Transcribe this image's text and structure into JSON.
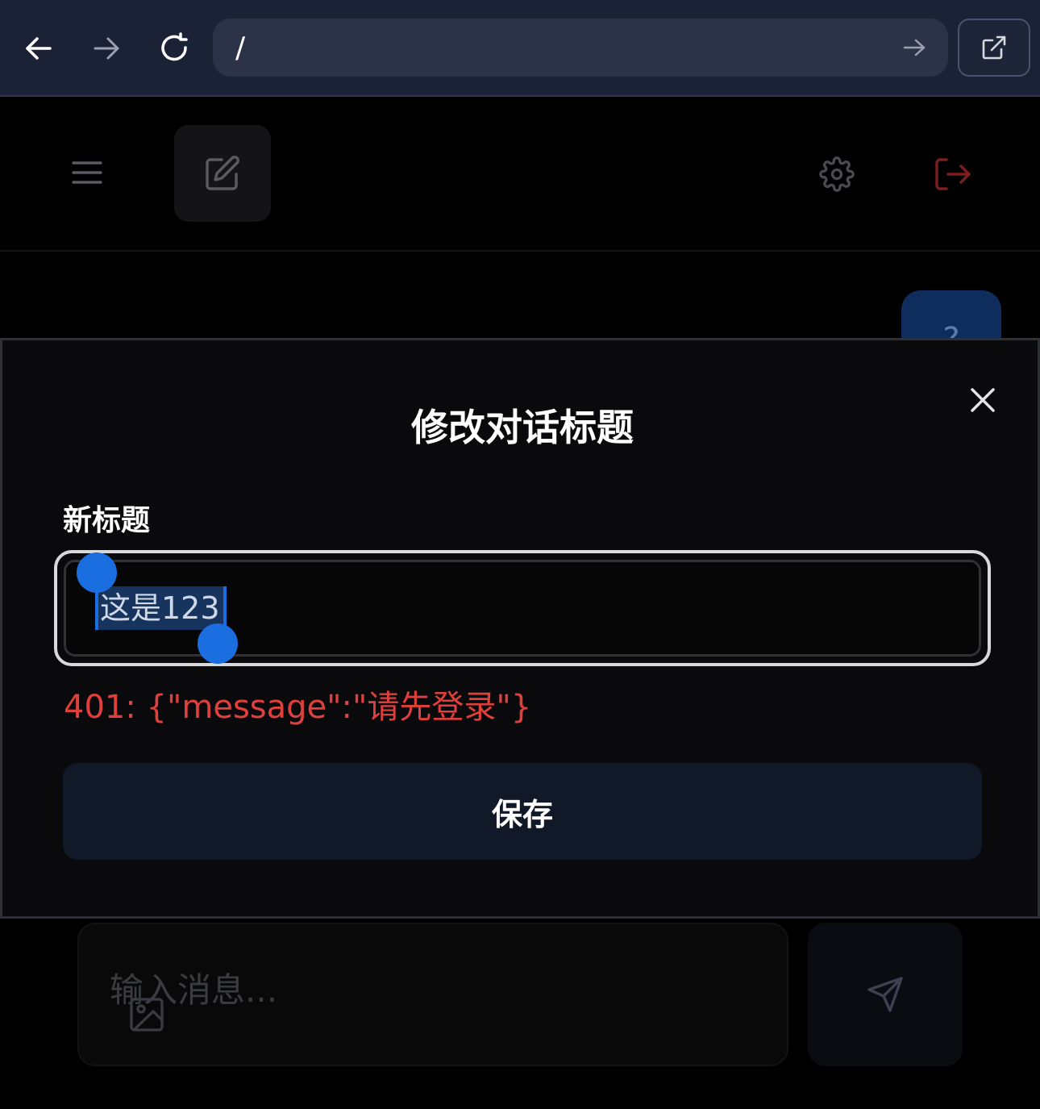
{
  "browser": {
    "url": "/",
    "icons": [
      "back-arrow-icon",
      "forward-arrow-icon",
      "reload-icon",
      "go-arrow-icon",
      "open-external-icon"
    ]
  },
  "header": {
    "icons": [
      "menu-icon",
      "edit-icon",
      "gear-icon",
      "logout-icon"
    ],
    "logout_color": "#7a1e1e"
  },
  "conversation": {
    "user_bubble_text": "?"
  },
  "modal": {
    "title": "修改对话标题",
    "field_label": "新标题",
    "input_value": "这是123",
    "error": "401: {\"message\":\"请先登录\"}",
    "save_label": "保存",
    "close_icon": "close-icon"
  },
  "composer": {
    "placeholder": "输入消息...",
    "icons": [
      "image-icon",
      "send-icon"
    ]
  },
  "colors": {
    "browser_bg": "#1b2236",
    "modal_bg": "#0a0a0c",
    "error": "#e0403c",
    "selection": "#1a6ee0",
    "save_button_bg": "#111828"
  }
}
